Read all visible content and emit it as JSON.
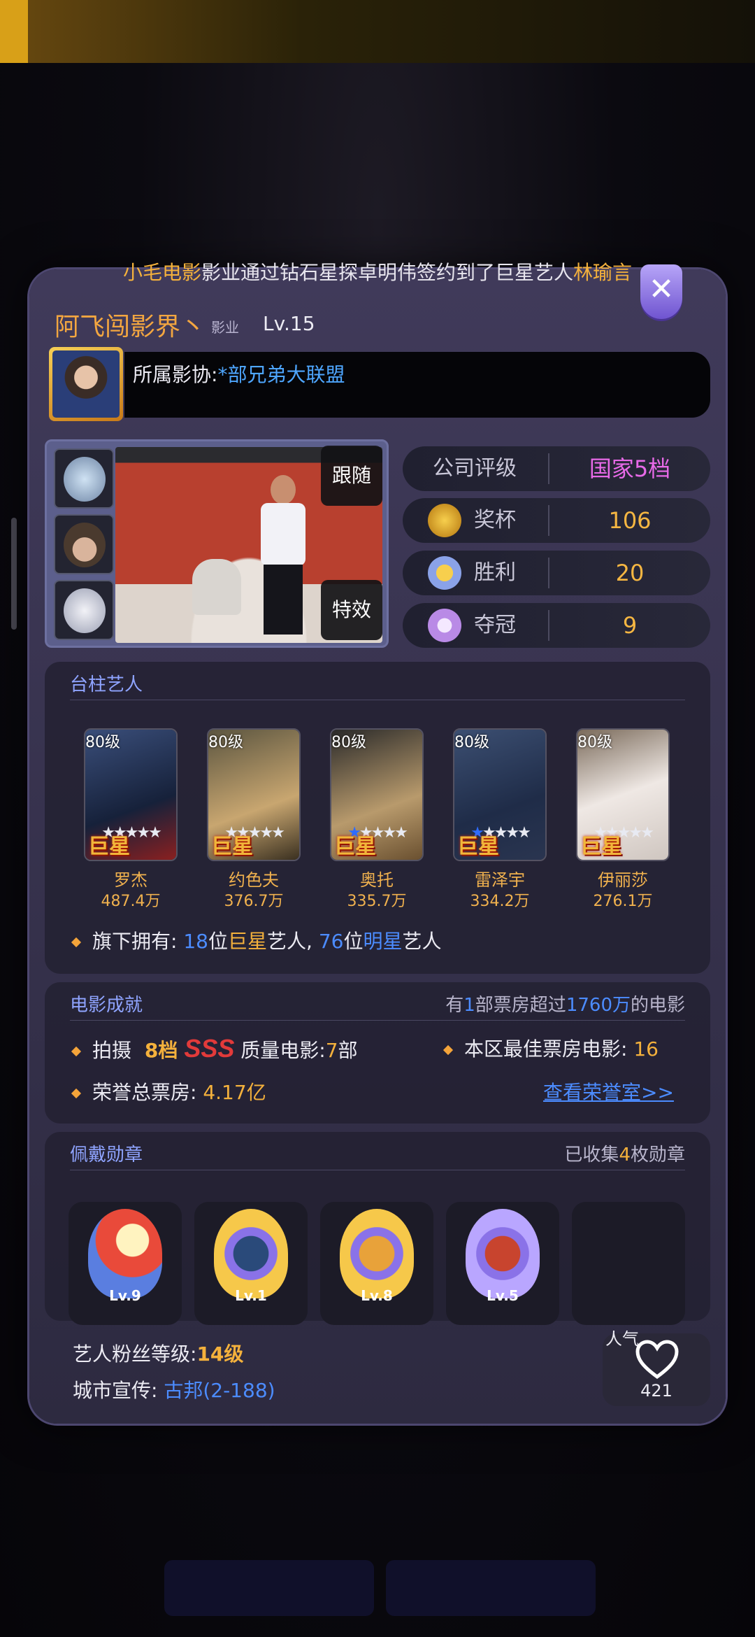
{
  "notice": {
    "company": "小毛电影",
    "text1": "影业通过钻石星探卓明伟签约到了巨星艺人",
    "artist": "林瑜言"
  },
  "profile": {
    "name": "阿飞闯影界丶",
    "type": "影业",
    "level": "Lv.15",
    "guild_label": "所属影协:",
    "guild_name": "*部兄弟大联盟"
  },
  "stage": {
    "follow": "跟随",
    "effect": "特效"
  },
  "stats": {
    "rating_label": "公司评级",
    "rating_value": "国家5档",
    "trophy_label": "奖杯",
    "trophy_value": "106",
    "win_label": "胜利",
    "win_value": "20",
    "champion_label": "夺冠",
    "champion_value": "9"
  },
  "artists": {
    "title": "台柱艺人",
    "items": [
      {
        "level": "80级",
        "badge": "巨星",
        "name": "罗杰",
        "value": "487.4万",
        "blue_stars": 0
      },
      {
        "level": "80级",
        "badge": "巨星",
        "name": "约色夫",
        "value": "376.7万",
        "blue_stars": 0
      },
      {
        "level": "80级",
        "badge": "巨星",
        "name": "奥托",
        "value": "335.7万",
        "blue_stars": 1
      },
      {
        "level": "80级",
        "badge": "巨星",
        "name": "雷泽宇",
        "value": "334.2万",
        "blue_stars": 1
      },
      {
        "level": "80级",
        "badge": "巨星",
        "name": "伊丽莎",
        "value": "276.1万",
        "blue_stars": 0
      }
    ],
    "own_label": "旗下拥有:",
    "superstar_count": "18",
    "unit1": "位",
    "superstar": "巨星",
    "artist_word": "艺人,",
    "star_count": "76",
    "unit2": "位",
    "star": "明星",
    "artist_word2": "艺人"
  },
  "film": {
    "title": "电影成就",
    "right_prefix": "有",
    "right_count": "1",
    "right_mid": "部票房超过",
    "right_amount": "1760万",
    "right_suffix": "的电影",
    "shoot_label": "拍摄",
    "tier": "8档",
    "quality": "SSS",
    "quality_suffix": "质量电影:",
    "film_count": "7",
    "film_unit": "部",
    "best_label": "本区最佳票房电影:",
    "best_value": "16",
    "box_label": "荣誉总票房:",
    "box_value": "4.17亿",
    "honor_link": "查看荣誉室>>"
  },
  "medals": {
    "title": "佩戴勋章",
    "collected_prefix": "已收集",
    "collected_count": "4",
    "collected_suffix": "枚勋章",
    "items": [
      {
        "level": "Lv.9"
      },
      {
        "level": "Lv.1"
      },
      {
        "level": "Lv.8"
      },
      {
        "level": "Lv.5"
      }
    ]
  },
  "fans": {
    "label": "艺人粉丝等级:",
    "level": "14级",
    "city_label": "城市宣传:",
    "city_value": "古邦(2-188)",
    "popularity_label": "人气",
    "popularity_value": "421"
  }
}
